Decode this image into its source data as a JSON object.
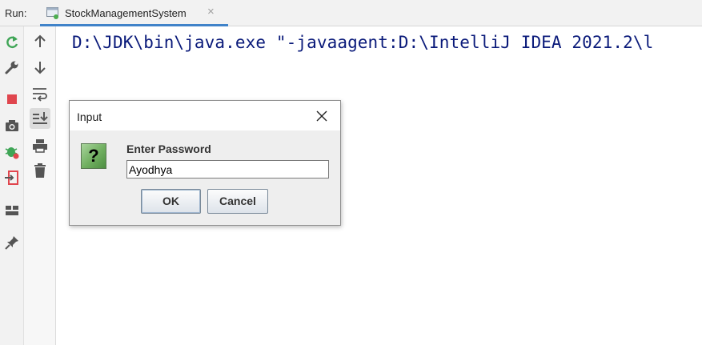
{
  "runbar": {
    "label": "Run:",
    "tab_title": "StockManagementSystem",
    "tab_close": "×"
  },
  "toolbar_primary": [
    "rerun-icon",
    "settings-wrench-icon",
    "stop-icon",
    "camera-icon",
    "debug-bug-icon",
    "exit-icon",
    "layout-icon",
    "pin-icon"
  ],
  "toolbar_secondary": [
    "arrow-up-icon",
    "arrow-down-icon",
    "soft-wrap-icon",
    "scroll-to-end-icon",
    "print-icon",
    "trash-icon"
  ],
  "console": {
    "line": "D:\\JDK\\bin\\java.exe \"-javaagent:D:\\IntelliJ IDEA 2021.2\\l"
  },
  "dialog": {
    "title": "Input",
    "icon": "question-icon",
    "icon_glyph": "?",
    "prompt": "Enter Password",
    "input_value": "Ayodhya",
    "ok_label": "OK",
    "cancel_label": "Cancel"
  },
  "colors": {
    "console_text": "#0a1a7a",
    "tab_underline": "#4083c9",
    "stop_red": "#e0464e",
    "rerun_green": "#3fa556"
  }
}
